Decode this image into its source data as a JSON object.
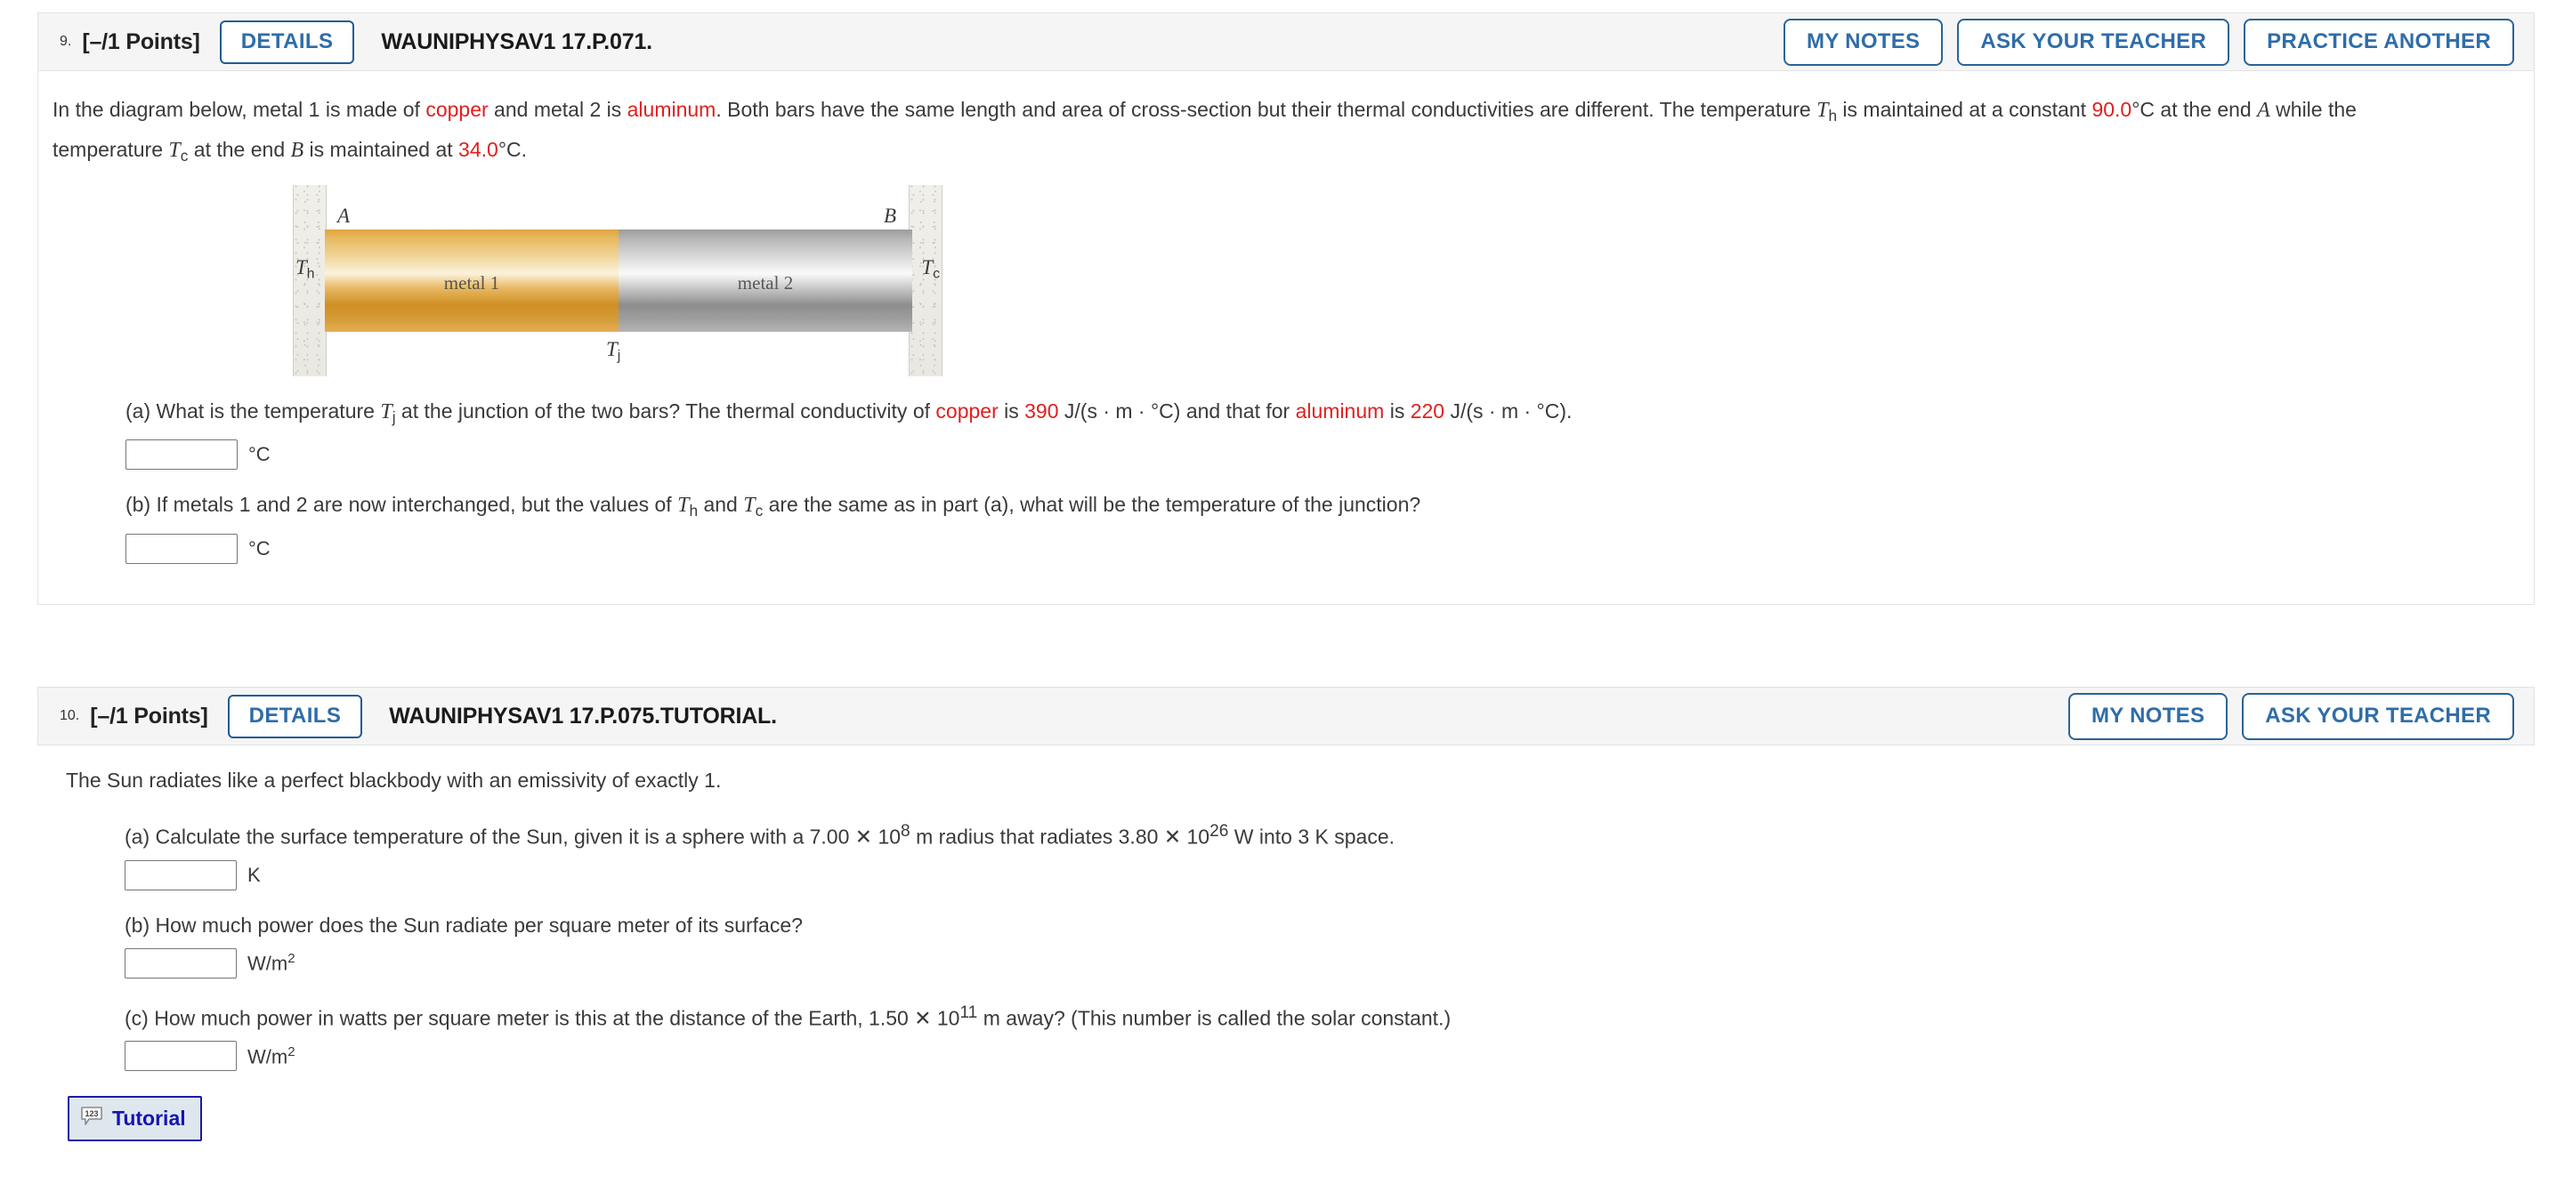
{
  "questions": [
    {
      "number": "9.",
      "points": "[–/1 Points]",
      "details_label": "DETAILS",
      "code": "WAUNIPHYSAV1 17.P.071.",
      "header_buttons": [
        "MY NOTES",
        "ASK YOUR TEACHER",
        "PRACTICE ANOTHER"
      ],
      "stem": {
        "p1": "In the diagram below, metal 1 is made of ",
        "copper": "copper",
        "p2": " and metal 2 is ",
        "aluminum": "aluminum",
        "p3": ". Both bars have the same length and area of cross-section but their thermal conductivities are different. The temperature ",
        "Th": "T",
        "Th_sub": "h",
        "p4": " is maintained at a constant ",
        "hot_temp": "90.0",
        "p5": "°C at the end ",
        "endA": "A",
        "p6": " while the temperature ",
        "Tc": "T",
        "Tc_sub": "c",
        "p7": " at the end ",
        "endB": "B",
        "p8": " is maintained at ",
        "cold_temp": "34.0",
        "p9": "°C."
      },
      "diagram": {
        "label_A": "A",
        "label_B": "B",
        "label_Th": "T",
        "label_Th_sub": "h",
        "label_Tc": "T",
        "label_Tc_sub": "c",
        "label_Tj": "T",
        "label_Tj_sub": "j",
        "bar1_label": "metal 1",
        "bar2_label": "metal 2",
        "bar1_color": "#e0a63f",
        "bar2_color": "#b0b0b0",
        "wall_color": "#eeece7"
      },
      "parts": [
        {
          "id": "a",
          "prefix": "(a) What is the temperature ",
          "sym": "T",
          "sym_sub": "j",
          "mid1": " at the junction of the two bars? The thermal conductivity of ",
          "mat1": "copper",
          "mid2": " is ",
          "val1": "390",
          "mid3": " J/(s · m · °C) and that for ",
          "mat2": "aluminum",
          "mid4": " is ",
          "val2": "220",
          "suffix": " J/(s · m · °C).",
          "answer_value": "",
          "unit": "°C"
        },
        {
          "id": "b",
          "prefix": "(b) If metals 1 and 2 are now interchanged, but the values of ",
          "sym": "T",
          "sym_sub": "h",
          "mid1": " and ",
          "sym2": "T",
          "sym2_sub": "c",
          "suffix": " are the same as in part (a), what will be the temperature of the junction?",
          "answer_value": "",
          "unit": "°C"
        }
      ]
    },
    {
      "number": "10.",
      "points": "[–/1 Points]",
      "details_label": "DETAILS",
      "code": "WAUNIPHYSAV1 17.P.075.TUTORIAL.",
      "header_buttons": [
        "MY NOTES",
        "ASK YOUR TEACHER"
      ],
      "stem_text": "The Sun radiates like a perfect blackbody with an emissivity of exactly 1.",
      "parts": [
        {
          "id": "a",
          "p1": "(a) Calculate the surface temperature of the Sun, given it is a sphere with a 7.00 ",
          "times1": "✕",
          "p2": " 10",
          "exp1": "8",
          "p3": " m radius that radiates 3.80 ",
          "times2": "✕",
          "p4": " 10",
          "exp2": "26",
          "p5": " W into 3 K space.",
          "answer_value": "",
          "unit": "K"
        },
        {
          "id": "b",
          "p1": "(b) How much power does the Sun radiate per square meter of its surface?",
          "answer_value": "",
          "unit": "W/m",
          "unit_exp": "2"
        },
        {
          "id": "c",
          "p1": "(c) How much power in watts per square meter is this at the distance of the Earth, 1.50 ",
          "times1": "✕",
          "p2": " 10",
          "exp1": "11",
          "p3": " m away? (This number is called the solar constant.)",
          "answer_value": "",
          "unit": "W/m",
          "unit_exp": "2"
        }
      ],
      "tutorial_button": {
        "label": "Tutorial",
        "icon": "123-speech-bubble-icon"
      }
    }
  ],
  "theme": {
    "accent_blue": "#2f6da8",
    "button_border": "#2a6496",
    "header_bg": "#f5f5f5",
    "red": "#e02020",
    "tutorial_blue": "#1414b4",
    "tutorial_bg": "#dfe7ee"
  }
}
